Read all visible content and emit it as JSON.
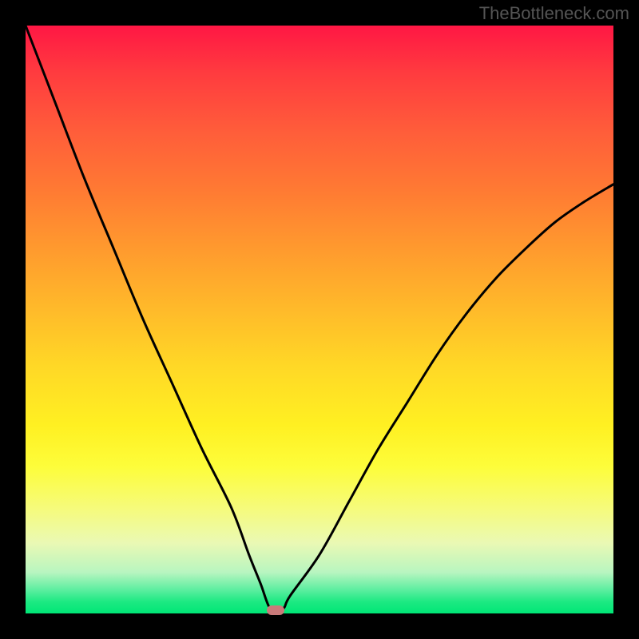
{
  "watermark": "TheBottleneck.com",
  "chart_data": {
    "type": "line",
    "title": "",
    "xlabel": "",
    "ylabel": "",
    "xlim": [
      0,
      100
    ],
    "ylim": [
      0,
      100
    ],
    "series": [
      {
        "name": "curve",
        "x": [
          0,
          5,
          10,
          15,
          20,
          25,
          30,
          35,
          38,
          40,
          41.5,
          43,
          44,
          45,
          50,
          55,
          60,
          65,
          70,
          75,
          80,
          85,
          90,
          95,
          100
        ],
        "y": [
          100,
          87,
          74,
          62,
          50,
          39,
          28,
          18,
          10,
          5,
          1,
          0.5,
          1,
          3,
          10,
          19,
          28,
          36,
          44,
          51,
          57,
          62,
          66.5,
          70,
          73
        ]
      }
    ],
    "marker": {
      "x": 42.5,
      "y": 0.5
    },
    "gradient_stops": [
      {
        "pos": 0,
        "color": "#ff1744"
      },
      {
        "pos": 50,
        "color": "#ffd826"
      },
      {
        "pos": 100,
        "color": "#00e676"
      }
    ]
  }
}
